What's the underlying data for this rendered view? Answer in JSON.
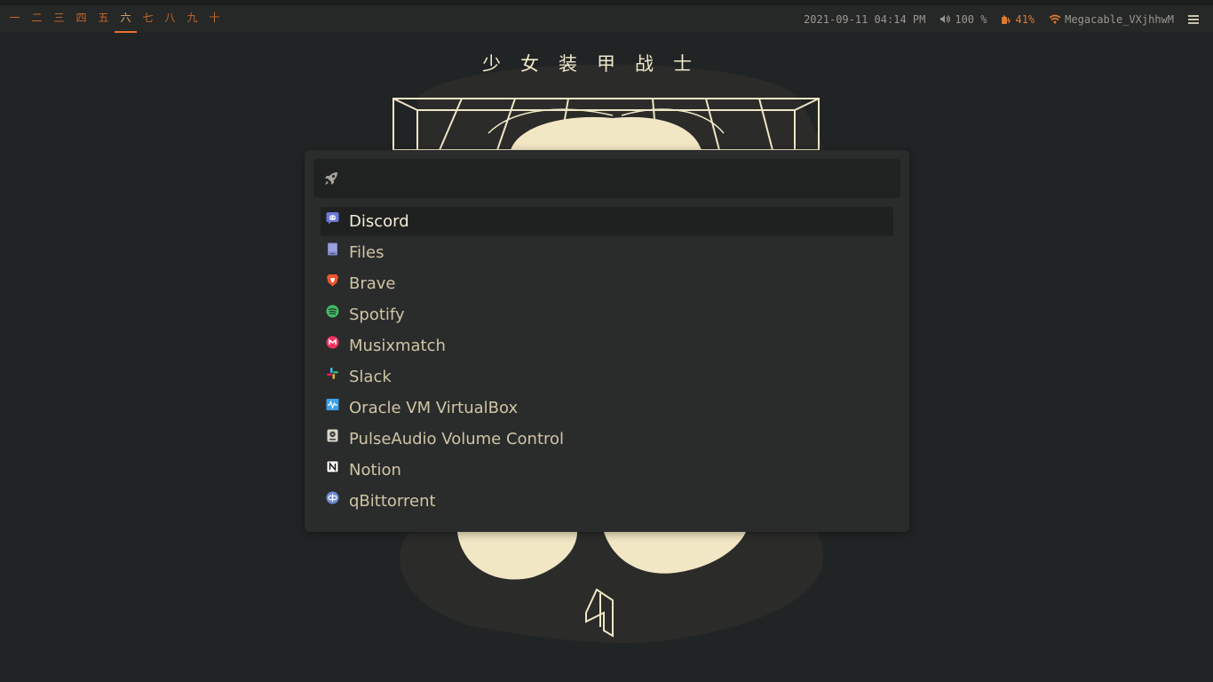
{
  "topbar": {
    "workspaces": [
      "一",
      "二",
      "三",
      "四",
      "五",
      "六",
      "七",
      "八",
      "九",
      "十"
    ],
    "active_workspace_index": 5,
    "datetime": "2021-09-11 04:14 PM",
    "volume": "100 %",
    "battery": "41%",
    "wifi": "Megacable_VXjhhwM",
    "accent_color": "#e8722a"
  },
  "wallpaper": {
    "title": "少女装甲战士"
  },
  "launcher": {
    "search": {
      "value": "",
      "placeholder": "",
      "icon": "rocket-icon"
    },
    "selected_index": 0,
    "items": [
      {
        "label": "Discord",
        "icon": "discord-icon"
      },
      {
        "label": "Files",
        "icon": "files-icon"
      },
      {
        "label": "Brave",
        "icon": "brave-icon"
      },
      {
        "label": "Spotify",
        "icon": "spotify-icon"
      },
      {
        "label": "Musixmatch",
        "icon": "musixmatch-icon"
      },
      {
        "label": "Slack",
        "icon": "slack-icon"
      },
      {
        "label": "Oracle VM VirtualBox",
        "icon": "virtualbox-icon"
      },
      {
        "label": "PulseAudio Volume Control",
        "icon": "pulseaudio-icon"
      },
      {
        "label": "Notion",
        "icon": "notion-icon"
      },
      {
        "label": "qBittorrent",
        "icon": "qbittorrent-icon"
      }
    ]
  }
}
